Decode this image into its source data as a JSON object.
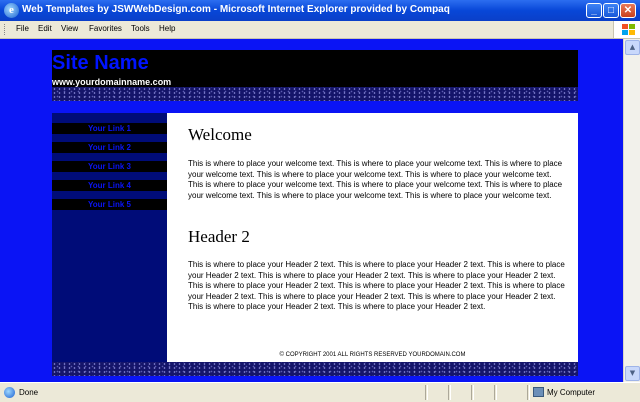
{
  "window": {
    "title": "Web Templates by JSWWebDesign.com - Microsoft Internet Explorer provided by Compaq",
    "ie_icon": "e",
    "minimize_glyph": "_",
    "maximize_glyph": "□",
    "close_glyph": "✕"
  },
  "menu": [
    "File",
    "Edit",
    "View",
    "Favorites",
    "Tools",
    "Help"
  ],
  "site": {
    "name": "Site Name",
    "url": "www.yourdomainname.com"
  },
  "links": [
    "Your Link 1",
    "Your Link 2",
    "Your Link 3",
    "Your Link 4",
    "Your Link 5"
  ],
  "content": {
    "welcome_heading": "Welcome",
    "welcome_text": "This is where to place your welcome text. This is where to place your welcome text. This is where to place your welcome text. This is where to place your welcome text. This is where to place your welcome text. This is where to place your welcome text. This is where to place your welcome text. This is where to place your welcome text. This is where to place your welcome text. This is where to place your welcome text.",
    "header2_heading": "Header 2",
    "header2_text": "This is where to place your Header 2 text. This is where to place your Header 2 text. This is where to place your Header 2 text. This is where to place your Header 2 text. This is where to place your Header 2 text. This is where to place your Header 2 text. This is where to place your Header 2 text. This is where to place your Header 2 text. This is where to place your Header 2 text. This is where to place your Header 2 text. This is where to place your Header 2 text. This is where to place your Header 2 text.",
    "copyright": "© COPYRIGHT 2001 ALL RIGHTS RESERVED YOURDOMAIN.COM"
  },
  "status": {
    "text": "Done",
    "zone": "My Computer"
  },
  "scrollbar": {
    "up_glyph": "▲",
    "down_glyph": "▼"
  },
  "colors": {
    "page_background": "#0a14f5",
    "site_name": "#0014ff",
    "sidebar": "#000c78",
    "link_text": "#0a14f5"
  }
}
